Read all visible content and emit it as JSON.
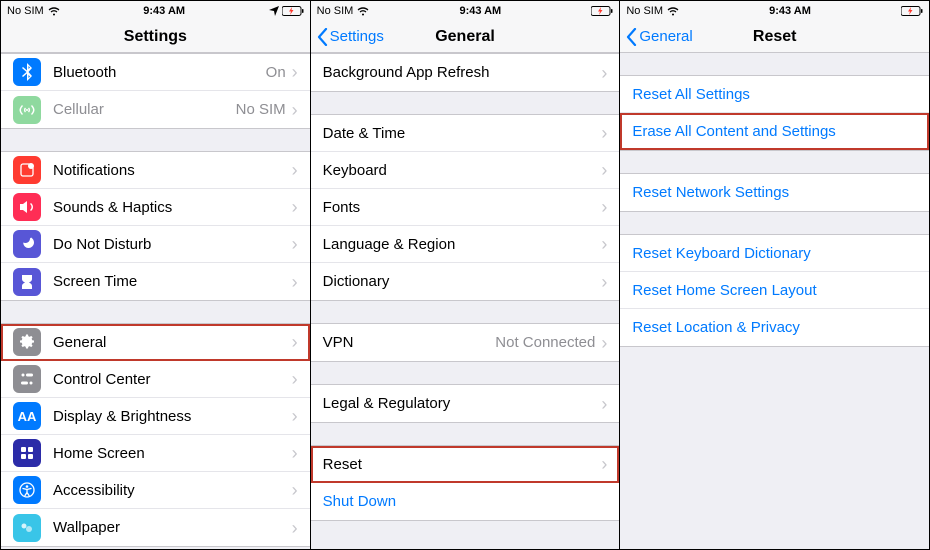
{
  "status": {
    "carrier": "No SIM",
    "time": "9:43 AM"
  },
  "screen1": {
    "title": "Settings",
    "group1": [
      {
        "id": "bluetooth",
        "label": "Bluetooth",
        "value": "On"
      },
      {
        "id": "cellular",
        "label": "Cellular",
        "value": "No SIM"
      }
    ],
    "group2": [
      {
        "id": "notifications",
        "label": "Notifications"
      },
      {
        "id": "sounds",
        "label": "Sounds & Haptics"
      },
      {
        "id": "dnd",
        "label": "Do Not Disturb"
      },
      {
        "id": "screentime",
        "label": "Screen Time"
      }
    ],
    "group3": [
      {
        "id": "general",
        "label": "General",
        "highlight": true
      },
      {
        "id": "controlcenter",
        "label": "Control Center"
      },
      {
        "id": "display",
        "label": "Display & Brightness"
      },
      {
        "id": "homescreen",
        "label": "Home Screen"
      },
      {
        "id": "accessibility",
        "label": "Accessibility"
      },
      {
        "id": "wallpaper",
        "label": "Wallpaper"
      }
    ]
  },
  "screen2": {
    "back": "Settings",
    "title": "General",
    "group1": [
      {
        "label": "Background App Refresh"
      }
    ],
    "group2": [
      {
        "label": "Date & Time"
      },
      {
        "label": "Keyboard"
      },
      {
        "label": "Fonts"
      },
      {
        "label": "Language & Region"
      },
      {
        "label": "Dictionary"
      }
    ],
    "group3": [
      {
        "label": "VPN",
        "value": "Not Connected"
      }
    ],
    "group4": [
      {
        "label": "Legal & Regulatory"
      }
    ],
    "group5": [
      {
        "label": "Reset",
        "highlight": true
      },
      {
        "label": "Shut Down",
        "blue": true,
        "nochev": true
      }
    ]
  },
  "screen3": {
    "back": "General",
    "title": "Reset",
    "group1": [
      {
        "label": "Reset All Settings"
      },
      {
        "label": "Erase All Content and Settings",
        "highlight": true
      }
    ],
    "group2": [
      {
        "label": "Reset Network Settings"
      }
    ],
    "group3": [
      {
        "label": "Reset Keyboard Dictionary"
      },
      {
        "label": "Reset Home Screen Layout"
      },
      {
        "label": "Reset Location & Privacy"
      }
    ]
  }
}
